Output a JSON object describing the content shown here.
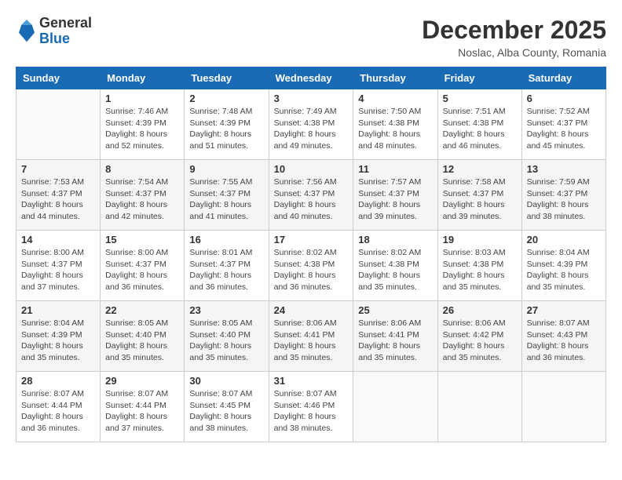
{
  "logo": {
    "general": "General",
    "blue": "Blue"
  },
  "title": "December 2025",
  "location": "Noslac, Alba County, Romania",
  "days_of_week": [
    "Sunday",
    "Monday",
    "Tuesday",
    "Wednesday",
    "Thursday",
    "Friday",
    "Saturday"
  ],
  "weeks": [
    [
      {
        "day": "",
        "sunrise": "",
        "sunset": "",
        "daylight": ""
      },
      {
        "day": "1",
        "sunrise": "Sunrise: 7:46 AM",
        "sunset": "Sunset: 4:39 PM",
        "daylight": "Daylight: 8 hours and 52 minutes."
      },
      {
        "day": "2",
        "sunrise": "Sunrise: 7:48 AM",
        "sunset": "Sunset: 4:39 PM",
        "daylight": "Daylight: 8 hours and 51 minutes."
      },
      {
        "day": "3",
        "sunrise": "Sunrise: 7:49 AM",
        "sunset": "Sunset: 4:38 PM",
        "daylight": "Daylight: 8 hours and 49 minutes."
      },
      {
        "day": "4",
        "sunrise": "Sunrise: 7:50 AM",
        "sunset": "Sunset: 4:38 PM",
        "daylight": "Daylight: 8 hours and 48 minutes."
      },
      {
        "day": "5",
        "sunrise": "Sunrise: 7:51 AM",
        "sunset": "Sunset: 4:38 PM",
        "daylight": "Daylight: 8 hours and 46 minutes."
      },
      {
        "day": "6",
        "sunrise": "Sunrise: 7:52 AM",
        "sunset": "Sunset: 4:37 PM",
        "daylight": "Daylight: 8 hours and 45 minutes."
      }
    ],
    [
      {
        "day": "7",
        "sunrise": "Sunrise: 7:53 AM",
        "sunset": "Sunset: 4:37 PM",
        "daylight": "Daylight: 8 hours and 44 minutes."
      },
      {
        "day": "8",
        "sunrise": "Sunrise: 7:54 AM",
        "sunset": "Sunset: 4:37 PM",
        "daylight": "Daylight: 8 hours and 42 minutes."
      },
      {
        "day": "9",
        "sunrise": "Sunrise: 7:55 AM",
        "sunset": "Sunset: 4:37 PM",
        "daylight": "Daylight: 8 hours and 41 minutes."
      },
      {
        "day": "10",
        "sunrise": "Sunrise: 7:56 AM",
        "sunset": "Sunset: 4:37 PM",
        "daylight": "Daylight: 8 hours and 40 minutes."
      },
      {
        "day": "11",
        "sunrise": "Sunrise: 7:57 AM",
        "sunset": "Sunset: 4:37 PM",
        "daylight": "Daylight: 8 hours and 39 minutes."
      },
      {
        "day": "12",
        "sunrise": "Sunrise: 7:58 AM",
        "sunset": "Sunset: 4:37 PM",
        "daylight": "Daylight: 8 hours and 39 minutes."
      },
      {
        "day": "13",
        "sunrise": "Sunrise: 7:59 AM",
        "sunset": "Sunset: 4:37 PM",
        "daylight": "Daylight: 8 hours and 38 minutes."
      }
    ],
    [
      {
        "day": "14",
        "sunrise": "Sunrise: 8:00 AM",
        "sunset": "Sunset: 4:37 PM",
        "daylight": "Daylight: 8 hours and 37 minutes."
      },
      {
        "day": "15",
        "sunrise": "Sunrise: 8:00 AM",
        "sunset": "Sunset: 4:37 PM",
        "daylight": "Daylight: 8 hours and 36 minutes."
      },
      {
        "day": "16",
        "sunrise": "Sunrise: 8:01 AM",
        "sunset": "Sunset: 4:37 PM",
        "daylight": "Daylight: 8 hours and 36 minutes."
      },
      {
        "day": "17",
        "sunrise": "Sunrise: 8:02 AM",
        "sunset": "Sunset: 4:38 PM",
        "daylight": "Daylight: 8 hours and 36 minutes."
      },
      {
        "day": "18",
        "sunrise": "Sunrise: 8:02 AM",
        "sunset": "Sunset: 4:38 PM",
        "daylight": "Daylight: 8 hours and 35 minutes."
      },
      {
        "day": "19",
        "sunrise": "Sunrise: 8:03 AM",
        "sunset": "Sunset: 4:38 PM",
        "daylight": "Daylight: 8 hours and 35 minutes."
      },
      {
        "day": "20",
        "sunrise": "Sunrise: 8:04 AM",
        "sunset": "Sunset: 4:39 PM",
        "daylight": "Daylight: 8 hours and 35 minutes."
      }
    ],
    [
      {
        "day": "21",
        "sunrise": "Sunrise: 8:04 AM",
        "sunset": "Sunset: 4:39 PM",
        "daylight": "Daylight: 8 hours and 35 minutes."
      },
      {
        "day": "22",
        "sunrise": "Sunrise: 8:05 AM",
        "sunset": "Sunset: 4:40 PM",
        "daylight": "Daylight: 8 hours and 35 minutes."
      },
      {
        "day": "23",
        "sunrise": "Sunrise: 8:05 AM",
        "sunset": "Sunset: 4:40 PM",
        "daylight": "Daylight: 8 hours and 35 minutes."
      },
      {
        "day": "24",
        "sunrise": "Sunrise: 8:06 AM",
        "sunset": "Sunset: 4:41 PM",
        "daylight": "Daylight: 8 hours and 35 minutes."
      },
      {
        "day": "25",
        "sunrise": "Sunrise: 8:06 AM",
        "sunset": "Sunset: 4:41 PM",
        "daylight": "Daylight: 8 hours and 35 minutes."
      },
      {
        "day": "26",
        "sunrise": "Sunrise: 8:06 AM",
        "sunset": "Sunset: 4:42 PM",
        "daylight": "Daylight: 8 hours and 35 minutes."
      },
      {
        "day": "27",
        "sunrise": "Sunrise: 8:07 AM",
        "sunset": "Sunset: 4:43 PM",
        "daylight": "Daylight: 8 hours and 36 minutes."
      }
    ],
    [
      {
        "day": "28",
        "sunrise": "Sunrise: 8:07 AM",
        "sunset": "Sunset: 4:44 PM",
        "daylight": "Daylight: 8 hours and 36 minutes."
      },
      {
        "day": "29",
        "sunrise": "Sunrise: 8:07 AM",
        "sunset": "Sunset: 4:44 PM",
        "daylight": "Daylight: 8 hours and 37 minutes."
      },
      {
        "day": "30",
        "sunrise": "Sunrise: 8:07 AM",
        "sunset": "Sunset: 4:45 PM",
        "daylight": "Daylight: 8 hours and 38 minutes."
      },
      {
        "day": "31",
        "sunrise": "Sunrise: 8:07 AM",
        "sunset": "Sunset: 4:46 PM",
        "daylight": "Daylight: 8 hours and 38 minutes."
      },
      {
        "day": "",
        "sunrise": "",
        "sunset": "",
        "daylight": ""
      },
      {
        "day": "",
        "sunrise": "",
        "sunset": "",
        "daylight": ""
      },
      {
        "day": "",
        "sunrise": "",
        "sunset": "",
        "daylight": ""
      }
    ]
  ]
}
